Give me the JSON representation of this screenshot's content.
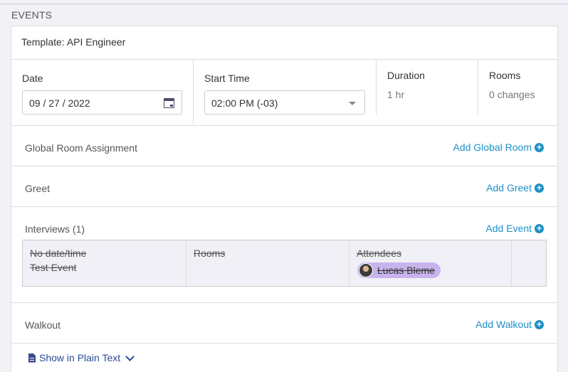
{
  "section_label": "EVENTS",
  "template_title": "Template: API Engineer",
  "fields": {
    "date_label": "Date",
    "date_value": "09 / 27 / 2022",
    "time_label": "Start Time",
    "time_value": "02:00 PM (-03)",
    "duration_label": "Duration",
    "duration_value": "1 hr",
    "rooms_label": "Rooms",
    "rooms_value": "0 changes"
  },
  "sections": {
    "global_room": {
      "title": "Global Room Assignment",
      "action": "Add Global Room"
    },
    "greet": {
      "title": "Greet",
      "action": "Add Greet"
    },
    "interviews": {
      "title": "Interviews (1)",
      "action": "Add Event"
    },
    "walkout": {
      "title": "Walkout",
      "action": "Add Walkout"
    }
  },
  "event_row": {
    "datetime": "No date/time",
    "name": "Test Event",
    "rooms_header": "Rooms",
    "attendees_header": "Attendees",
    "attendee": "Lucas Bleme"
  },
  "plain_text_label": "Show in Plain Text",
  "icons": {
    "calendar": "calendar-icon",
    "caret": "caret-down-icon",
    "plus": "plus-circle-icon",
    "document": "document-icon",
    "chevron": "chevron-down-icon"
  },
  "colors": {
    "link": "#1e90c8",
    "chip": "#c8b4ec",
    "plain_link": "#2a4a9a"
  }
}
